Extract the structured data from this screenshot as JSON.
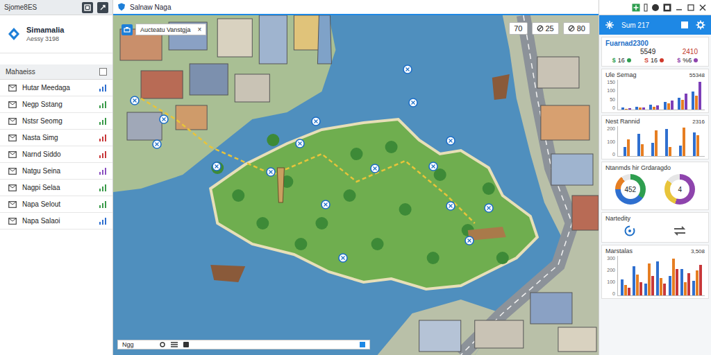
{
  "window": {
    "title": "Sjome8ES",
    "map_title": "Salnaw Naga"
  },
  "app": {
    "name": "Simamalia",
    "subtitle": "Aessy 3198"
  },
  "sidebar": {
    "header": "Mahaeiss",
    "checked": false,
    "items": [
      {
        "label": "Hutar Meedaga",
        "color": "#2f6fcf"
      },
      {
        "label": "Negp Sstang",
        "color": "#3a9a4a"
      },
      {
        "label": "Nstsr Seomg",
        "color": "#3a9a4a"
      },
      {
        "label": "Nasta Simg",
        "color": "#c8383a"
      },
      {
        "label": "Narnd Siddo",
        "color": "#c8383a"
      },
      {
        "label": "Natgu Seina",
        "color": "#8a4fc0"
      },
      {
        "label": "Nagpi Selaa",
        "color": "#3a9a4a"
      },
      {
        "label": "Napa Selout",
        "color": "#3a9a4a"
      },
      {
        "label": "Napa Salaoi",
        "color": "#2f6fcf"
      }
    ]
  },
  "map": {
    "tab": "Aucteatu Vanstgja",
    "close": "×",
    "counters": [
      "70",
      "25",
      "80"
    ]
  },
  "status_bar": {
    "label": "Ngg"
  },
  "panel": {
    "title": "Sum 217",
    "headline": "Fuarnad2300",
    "figures": [
      "5549",
      "2410"
    ],
    "badges": [
      {
        "icon": "$",
        "value": "16",
        "color": "#2e9e4f"
      },
      {
        "icon": "S",
        "value": "16",
        "color": "#d0392b"
      },
      {
        "icon": "$",
        "value": "%6",
        "color": "#8e44ad"
      }
    ],
    "sections": [
      {
        "kind": "chart",
        "title": "Ule Semag",
        "value": "55348",
        "ticks": [
          "150",
          "100",
          "50",
          "0"
        ],
        "series": [
          {
            "color": "#2f6fcf",
            "values": [
              10,
              15,
              25,
              40,
              60,
              90
            ]
          },
          {
            "color": "#e67e22",
            "values": [
              5,
              10,
              15,
              30,
              50,
              70
            ]
          },
          {
            "color": "#7d3fb8",
            "values": [
              8,
              12,
              20,
              45,
              80,
              140
            ]
          }
        ]
      },
      {
        "kind": "chart",
        "title": "Nest Rannid",
        "value": "2316",
        "ticks": [
          "200",
          "100",
          "0"
        ],
        "series": [
          {
            "color": "#2f6fcf",
            "values": [
              60,
              150,
              90,
              180,
              70,
              160
            ]
          },
          {
            "color": "#e67e22",
            "values": [
              110,
              80,
              170,
              60,
              190,
              140
            ]
          }
        ]
      },
      {
        "kind": "donuts",
        "title": "Ntanmds hir Grdaragdo",
        "items": [
          {
            "value": "452",
            "segments": [
              {
                "level": 0.35,
                "color": "#2e9e4f"
              },
              {
                "level": 0.4,
                "color": "#2f6fcf"
              },
              {
                "level": 0.15,
                "color": "#e67e22"
              }
            ]
          },
          {
            "value": "4",
            "segments": [
              {
                "level": 0.55,
                "color": "#8e44ad"
              },
              {
                "level": 0.3,
                "color": "#e8c43a"
              }
            ]
          }
        ]
      },
      {
        "kind": "activity",
        "title": "Nartedity"
      },
      {
        "kind": "chart",
        "title": "Marstalas",
        "value": "3,508",
        "ticks": [
          "300",
          "200",
          "100",
          "0"
        ],
        "series": [
          {
            "color": "#2f6fcf",
            "values": [
              120,
              220,
              90,
              260,
              150,
              200,
              110
            ]
          },
          {
            "color": "#e67e22",
            "values": [
              80,
              160,
              240,
              130,
              280,
              100,
              190
            ]
          },
          {
            "color": "#c8383a",
            "values": [
              60,
              100,
              150,
              90,
              200,
              170,
              230
            ]
          }
        ]
      }
    ]
  }
}
